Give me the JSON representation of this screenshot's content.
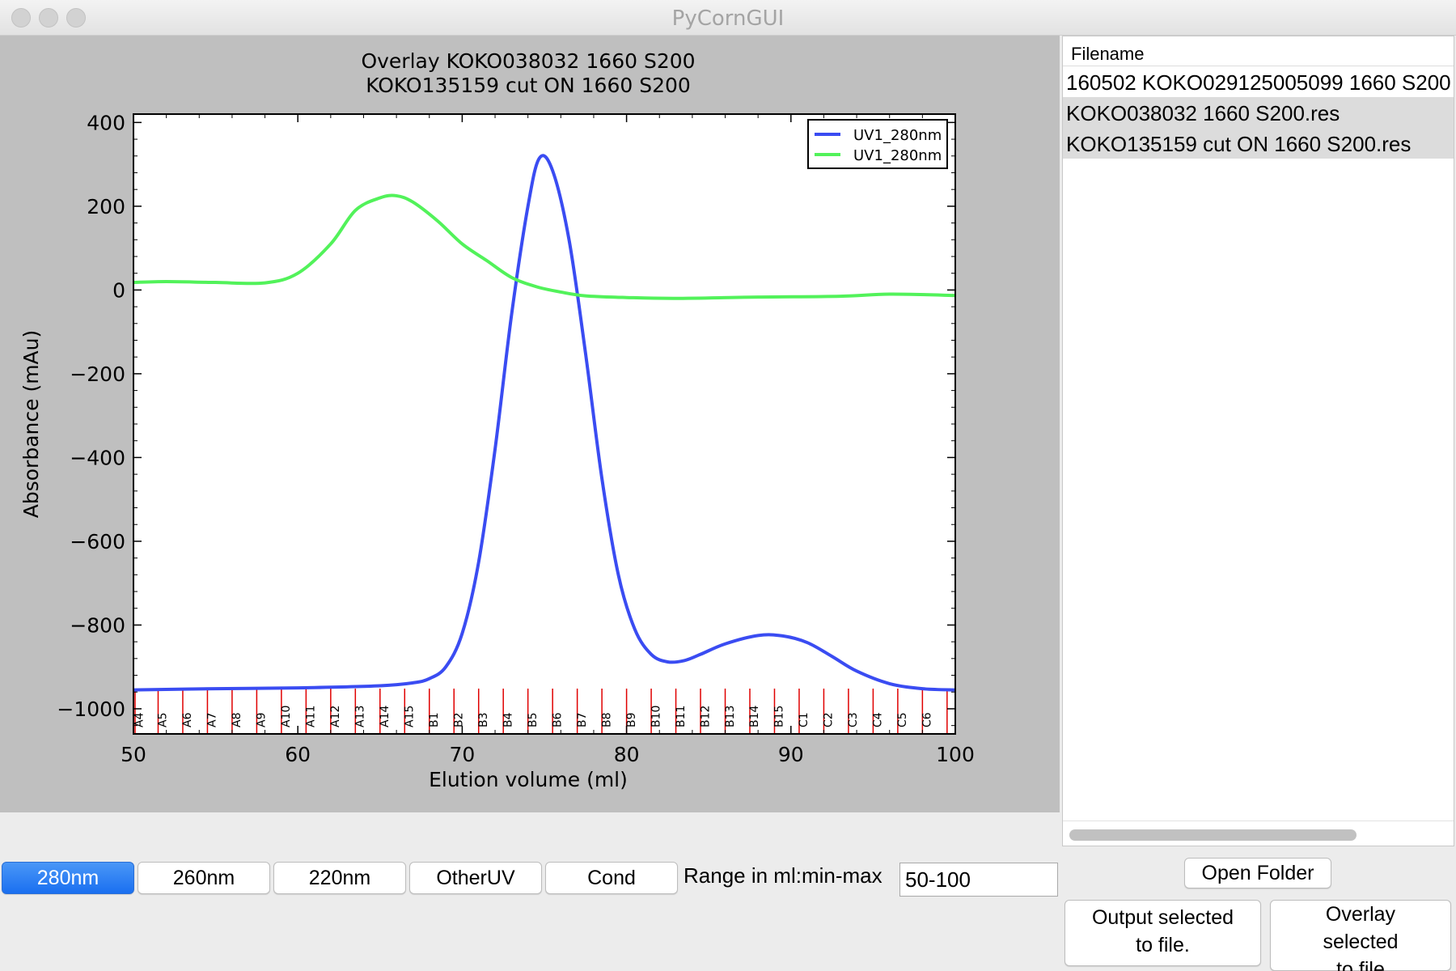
{
  "window": {
    "title": "PyCornGUI"
  },
  "chart_data": {
    "type": "line",
    "title": "Overlay KOKO038032 1660 S200\nKOKO135159 cut ON 1660 S200",
    "title_lines": [
      "Overlay KOKO038032 1660 S200",
      "KOKO135159 cut ON 1660 S200"
    ],
    "xlabel": "Elution volume (ml)",
    "ylabel": "Absorbance (mAu)",
    "xlim": [
      50,
      100
    ],
    "ylim": [
      -1060,
      420
    ],
    "xticks": [
      "50",
      "60",
      "70",
      "80",
      "90",
      "100"
    ],
    "yticks": [
      "400",
      "200",
      "0",
      "−200",
      "−400",
      "−600",
      "−800",
      "−1000"
    ],
    "grid": false,
    "legend_position": "top-right",
    "series": [
      {
        "name": "UV1_280nm",
        "color": "#3a4cf2",
        "x": [
          50,
          55,
          60,
          65,
          67,
          68,
          69,
          70,
          71,
          72,
          73,
          74,
          74.7,
          75.5,
          76.5,
          77.5,
          78.5,
          79.5,
          80.5,
          81.5,
          82.5,
          83.5,
          84.5,
          86,
          88,
          89.5,
          91,
          92.5,
          94,
          96,
          98,
          100
        ],
        "y": [
          -955,
          -952,
          -950,
          -945,
          -938,
          -928,
          -900,
          -820,
          -650,
          -380,
          -60,
          200,
          315,
          285,
          120,
          -150,
          -450,
          -680,
          -810,
          -870,
          -888,
          -885,
          -870,
          -845,
          -825,
          -826,
          -842,
          -875,
          -910,
          -940,
          -952,
          -955
        ]
      },
      {
        "name": "UV1_280nm",
        "color": "#52f25a",
        "x": [
          50,
          52,
          55,
          58,
          60,
          62,
          63.5,
          65,
          66,
          67,
          68.5,
          70,
          71.5,
          73,
          74.5,
          76,
          77.5,
          80,
          83,
          88,
          93,
          96,
          100
        ],
        "y": [
          18,
          20,
          18,
          17,
          40,
          110,
          190,
          220,
          225,
          210,
          165,
          110,
          70,
          30,
          8,
          -5,
          -14,
          -18,
          -20,
          -17,
          -15,
          -10,
          -13
        ]
      }
    ],
    "fractions": {
      "color": "#e00000",
      "labels": [
        "A4",
        "A5",
        "A6",
        "A7",
        "A8",
        "A9",
        "A10",
        "A11",
        "A12",
        "A13",
        "A14",
        "A15",
        "B1",
        "B2",
        "B3",
        "B4",
        "B5",
        "B6",
        "B7",
        "B8",
        "B9",
        "B10",
        "B11",
        "B12",
        "B13",
        "B14",
        "B15",
        "C1",
        "C2",
        "C3",
        "C4",
        "C5",
        "C6"
      ],
      "positions_ml": [
        50.1,
        51.5,
        53,
        54.5,
        56,
        57.5,
        59,
        60.5,
        62,
        63.5,
        65,
        66.5,
        68,
        69.5,
        71,
        72.5,
        74,
        75.5,
        77,
        78.5,
        80,
        81.5,
        83,
        84.5,
        86,
        87.5,
        89,
        90.5,
        92,
        93.5,
        95,
        96.5,
        98,
        99.5
      ]
    }
  },
  "file_list": {
    "header": "Filename",
    "items": [
      {
        "label": "160502 KOKO029125005099 1660 S200",
        "selected": false
      },
      {
        "label": "KOKO038032 1660 S200.res",
        "selected": true
      },
      {
        "label": "KOKO135159 cut ON 1660 S200.res",
        "selected": true
      }
    ]
  },
  "buttons": {
    "b280": "280nm",
    "b260": "260nm",
    "b220": "220nm",
    "other": "OtherUV",
    "cond": "Cond",
    "open_folder": "Open Folder",
    "output_line1": "Output selected",
    "output_line2": "to file.",
    "overlay_line1": "Overlay",
    "overlay_line2": "selected",
    "overlay_line3": "to file"
  },
  "range": {
    "label": "Range in ml:min-max",
    "value": "50-100"
  },
  "colors": {
    "active_button": "#1a6ff0",
    "plot_background": "#bfbfbf"
  }
}
